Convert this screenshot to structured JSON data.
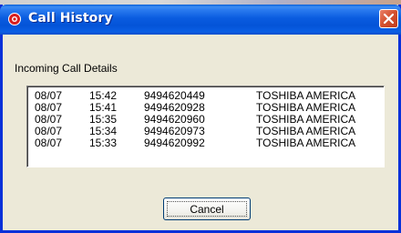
{
  "window": {
    "title": "Call History",
    "accent_color": "#0a5ce0",
    "close_button_color": "#d4502e",
    "icon": "red-ring-app-icon"
  },
  "section": {
    "label": "Incoming Call Details"
  },
  "calls": [
    {
      "date": "08/07",
      "time": "15:42",
      "number": "9494620449",
      "name": "TOSHIBA AMERICA"
    },
    {
      "date": "08/07",
      "time": "15:41",
      "number": "9494620928",
      "name": "TOSHIBA AMERICA"
    },
    {
      "date": "08/07",
      "time": "15:35",
      "number": "9494620960",
      "name": "TOSHIBA AMERICA"
    },
    {
      "date": "08/07",
      "time": "15:34",
      "number": "9494620973",
      "name": "TOSHIBA AMERICA"
    },
    {
      "date": "08/07",
      "time": "15:33",
      "number": "9494620992",
      "name": "TOSHIBA AMERICA"
    }
  ],
  "buttons": {
    "cancel_label": "Cancel"
  }
}
